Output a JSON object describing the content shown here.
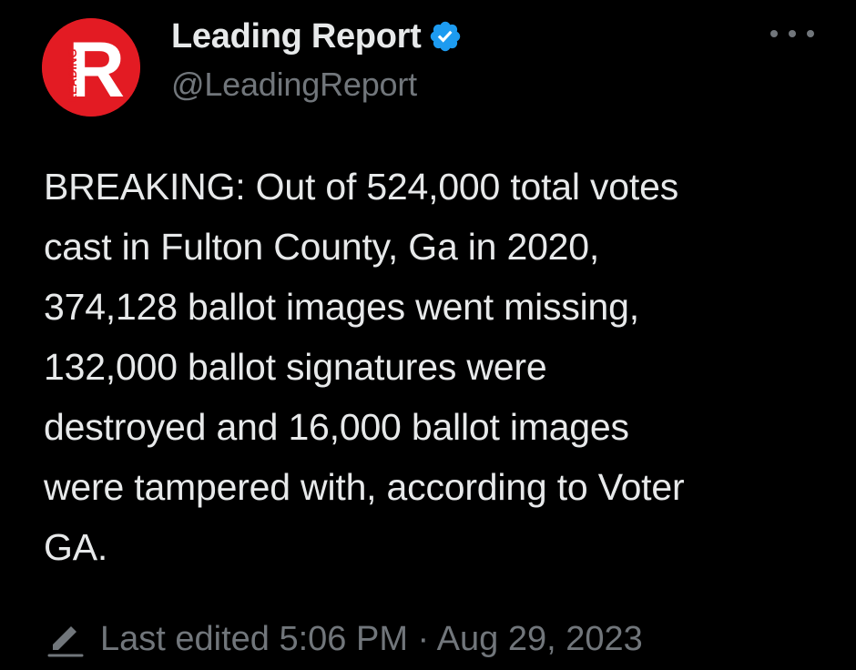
{
  "author": {
    "display_name": "Leading Report",
    "handle": "@LeadingReport",
    "avatar_letter": "R",
    "avatar_side_text": "LEADING",
    "verified": true,
    "verified_icon": "verified-badge-icon"
  },
  "menu": {
    "icon": "more-options-icon"
  },
  "tweet": {
    "text": "BREAKING: Out of 524,000 total votes\ncast in Fulton County, Ga in 2020,\n374,128 ballot images went missing,\n132,000 ballot signatures were\ndestroyed and 16,000 ballot images\nwere tampered with, according to Voter\nGA."
  },
  "edit_info": {
    "icon": "pencil-icon",
    "label": "Last edited 5:06 PM · Aug 29, 2023"
  },
  "colors": {
    "background": "#000000",
    "primary_text": "#e7e9ea",
    "secondary_text": "#71767b",
    "verified_blue": "#1d9bf0",
    "avatar_red": "#e31b23"
  }
}
